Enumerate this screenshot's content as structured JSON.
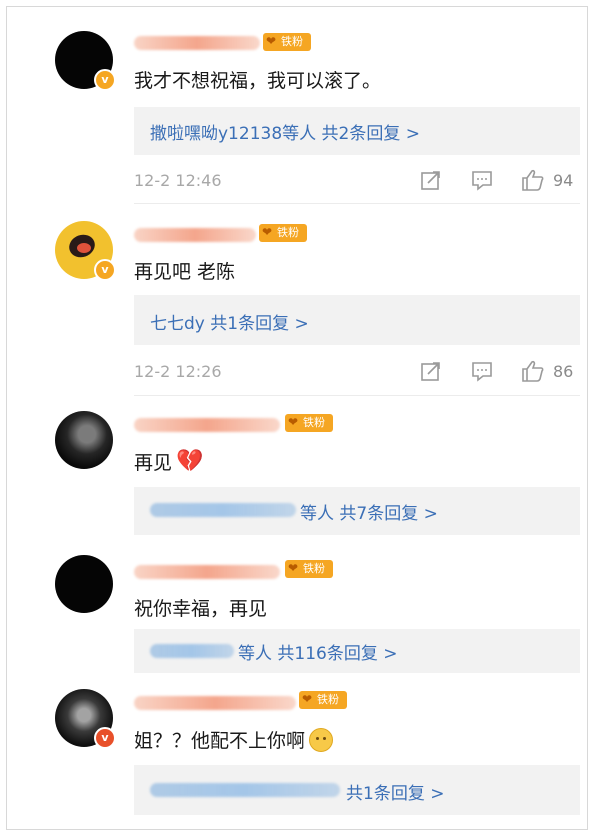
{
  "comments": [
    {
      "fan_badge": "铁粉",
      "text": "我才不想祝福，我可以滚了。",
      "reply_summary": "撒啦嘿呦y12138等人  共2条回复 >",
      "time": "12-2 12:46",
      "likes": "94"
    },
    {
      "fan_badge": "铁粉",
      "text": "再见吧 老陈",
      "reply_summary": "七七dy  共1条回复 >",
      "time": "12-2 12:26",
      "likes": "86"
    },
    {
      "fan_badge": "铁粉",
      "text": "再见",
      "reply_summary": "等人  共7条回复 >"
    },
    {
      "fan_badge": "铁粉",
      "text": "祝你幸福，再见",
      "reply_summary": "等人  共116条回复 >"
    },
    {
      "fan_badge": "铁粉",
      "text": "姐？？他配不上你啊",
      "reply_summary": "共1条回复 >"
    }
  ],
  "icons": {
    "share": "share-icon",
    "comment": "comment-icon",
    "like": "like-icon",
    "broken_heart": "broken-heart-emoji",
    "sad_face": "sad-face-emoji",
    "verified": "verified-badge-icon"
  },
  "colors": {
    "link": "#3b6fb6",
    "badge": "#f5a623",
    "meta": "#a8a8a8"
  }
}
